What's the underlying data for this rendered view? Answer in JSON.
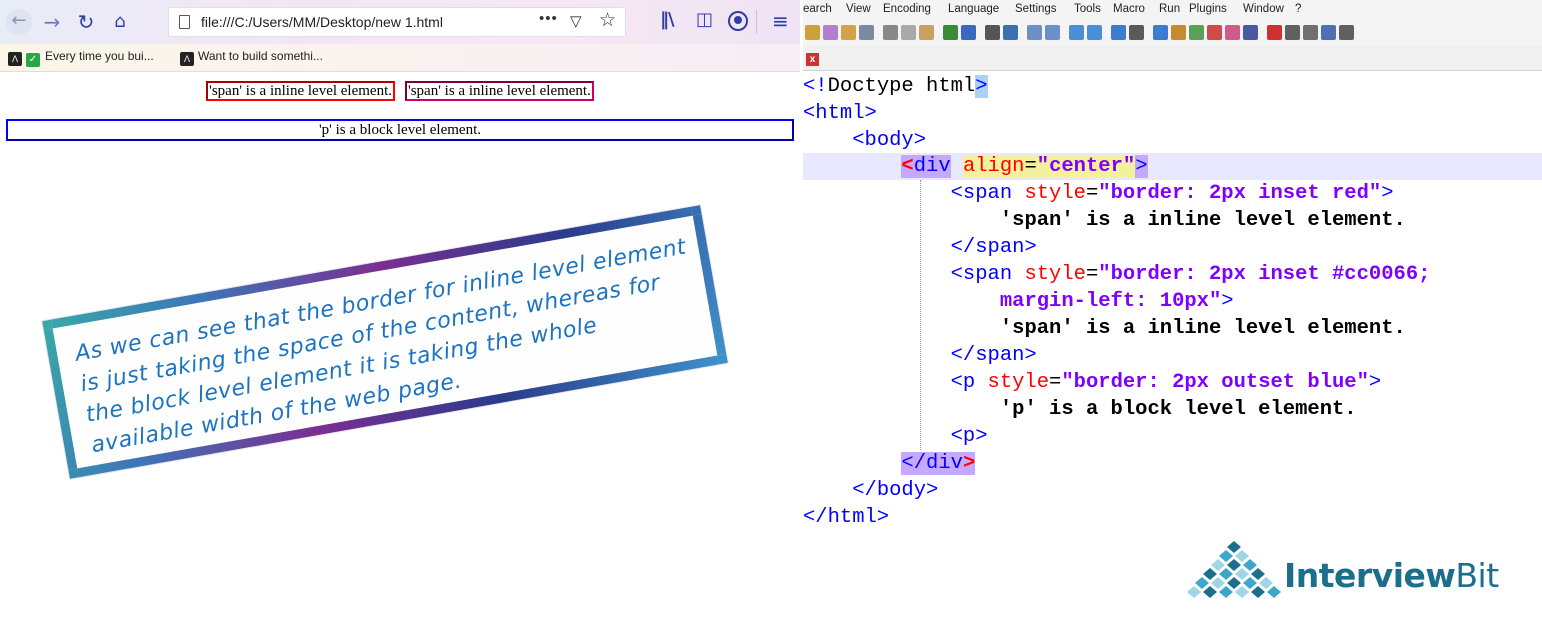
{
  "browser": {
    "url": "file:///C:/Users/MM/Desktop/new 1.html",
    "url_menu": "•••",
    "bookmarks": [
      {
        "label": "Every time you bui..."
      },
      {
        "label": "Want to build somethi..."
      }
    ],
    "page": {
      "span1": "'span' is a inline level element.",
      "span2": "'span' is a inline level element.",
      "paragraph": "'p' is a block level element."
    }
  },
  "annotation": {
    "text": "As we can see that the border for inline level element is just taking the space of the content, whereas for the block level element it is taking the whole available width of the web page."
  },
  "editor": {
    "menu": [
      "earch",
      "View",
      "Encoding",
      "Language",
      "Settings",
      "Tools",
      "Macro",
      "Run",
      "Plugins",
      "Window",
      "?"
    ],
    "code": {
      "l1a": "<!",
      "l1b": "Doctype html",
      "l1c": ">",
      "l2": "<html>",
      "l3": "<body>",
      "l4_open": "<",
      "l4_tag": "div",
      "l4_attr": "align",
      "l4_eq": "=",
      "l4_val": "\"center\"",
      "l4_close": ">",
      "l5_tag": "<span ",
      "l5_attr": "style",
      "l5_eq": "=",
      "l5_val": "\"border: 2px inset red\"",
      "l5_close": ">",
      "l6": "'span' is a inline level element.",
      "l7": "</span>",
      "l8_tag": "<span ",
      "l8_attr": "style",
      "l8_eq": "=",
      "l8_val": "\"border: 2px inset #cc0066;",
      "l9_val": "margin-left: 10px\"",
      "l9_close": ">",
      "l10": "'span' is a inline level element.",
      "l11": "</span>",
      "l12_tag": "<p ",
      "l12_attr": "style",
      "l12_eq": "=",
      "l12_val": "\"border: 2px outset blue\"",
      "l12_close": ">",
      "l13": "'p' is a block level element.",
      "l14": "<p>",
      "l15a": "</",
      "l15b": "div",
      "l15c": ">",
      "l16": "</body>",
      "l17": "</html>"
    }
  },
  "logo": {
    "bold": "Interview",
    "light": "Bit",
    "colors": {
      "diamond_dark": "#1b6f8c",
      "diamond_mid": "#3ba7c9",
      "diamond_light": "#9fd6e6"
    }
  }
}
